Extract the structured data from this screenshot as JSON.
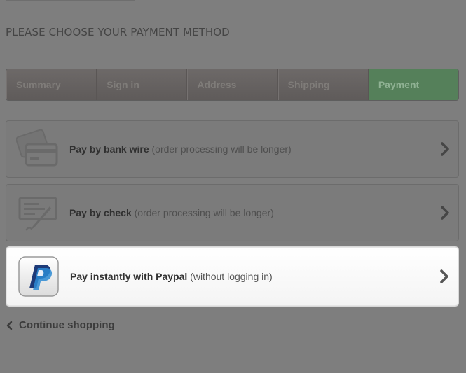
{
  "page_heading": "PLEASE CHOOSE YOUR PAYMENT METHOD",
  "steps": [
    {
      "label": "Summary"
    },
    {
      "label": "Sign in"
    },
    {
      "label": "Address"
    },
    {
      "label": "Shipping"
    },
    {
      "label": "Payment"
    }
  ],
  "payment_options": [
    {
      "label": "Pay by bank wire",
      "note": "(order processing will be longer)",
      "icon": "bank-card-icon"
    },
    {
      "label": "Pay by check",
      "note": "(order processing will be longer)",
      "icon": "check-pen-icon"
    },
    {
      "label": "Pay instantly with Paypal",
      "note": "(without logging in)",
      "icon": "paypal-logo-icon"
    }
  ],
  "continue_label": "Continue shopping",
  "colors": {
    "active_step": "#55805a",
    "overlay": "#7e7e7e"
  }
}
